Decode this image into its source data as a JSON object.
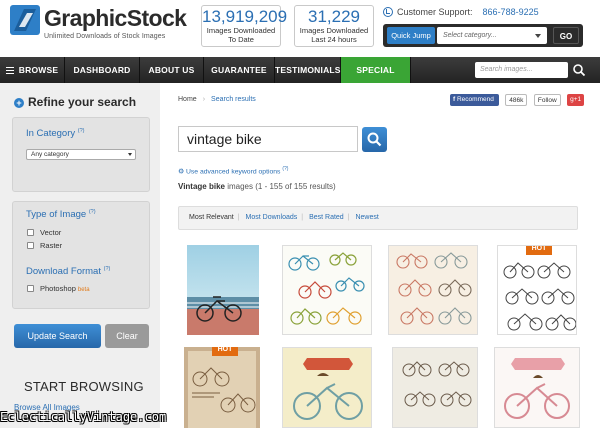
{
  "header": {
    "logo_text": "GraphicStock",
    "tagline": "Unlimited Downloads of Stock Images",
    "stats": [
      {
        "number": "13,919,209",
        "label_1": "Images Downloaded",
        "label_2": "To Date"
      },
      {
        "number": "31,229",
        "label_1": "Images Downloaded",
        "label_2": "Last 24 hours"
      }
    ],
    "support_label": "Customer Support:",
    "support_phone": "866-788-9225",
    "quick_jump_label": "Quick Jump",
    "category_placeholder": "Select category...",
    "go_label": "GO"
  },
  "nav": {
    "items": [
      "BROWSE",
      "DASHBOARD",
      "ABOUT US",
      "GUARANTEE",
      "TESTIMONIALS",
      "SPECIAL OFFER"
    ],
    "search_placeholder": "Search images..."
  },
  "sidebar": {
    "title": "Refine your search",
    "category_heading": "In Category",
    "category_help": "(?)",
    "category_value": "Any category",
    "type_heading": "Type of Image",
    "type_help": "(?)",
    "type_options": [
      "Vector",
      "Raster"
    ],
    "format_heading": "Download Format",
    "format_help": "(?)",
    "format_option": "Photoshop",
    "format_beta": "beta",
    "update_label": "Update Search",
    "clear_label": "Clear",
    "start_browsing": "START BROWSING",
    "browse_all": "Browse All Images"
  },
  "main": {
    "breadcrumb": [
      "Home",
      "Search results"
    ],
    "social": {
      "facebook": "Recommend",
      "twitter_count": "486k",
      "twitter": "Follow",
      "gplus": "g+1"
    },
    "query": "vintage bike",
    "advanced_link": "Use advanced keyword options",
    "advanced_help": "(?)",
    "results_query": "Vintage bike",
    "results_text": "images (1 - 155 of 155 results)",
    "sort_options": [
      "Most Relevant",
      "Most Downloads",
      "Best Rated",
      "Newest"
    ],
    "hot_label": "HOT"
  },
  "watermark": "EclecticallyVintage.com",
  "colors": {
    "brand_blue": "#2e7fc7",
    "special_offer": "#3aa535",
    "hot": "#e26b10",
    "nav_dark": "#2b2b2b"
  }
}
